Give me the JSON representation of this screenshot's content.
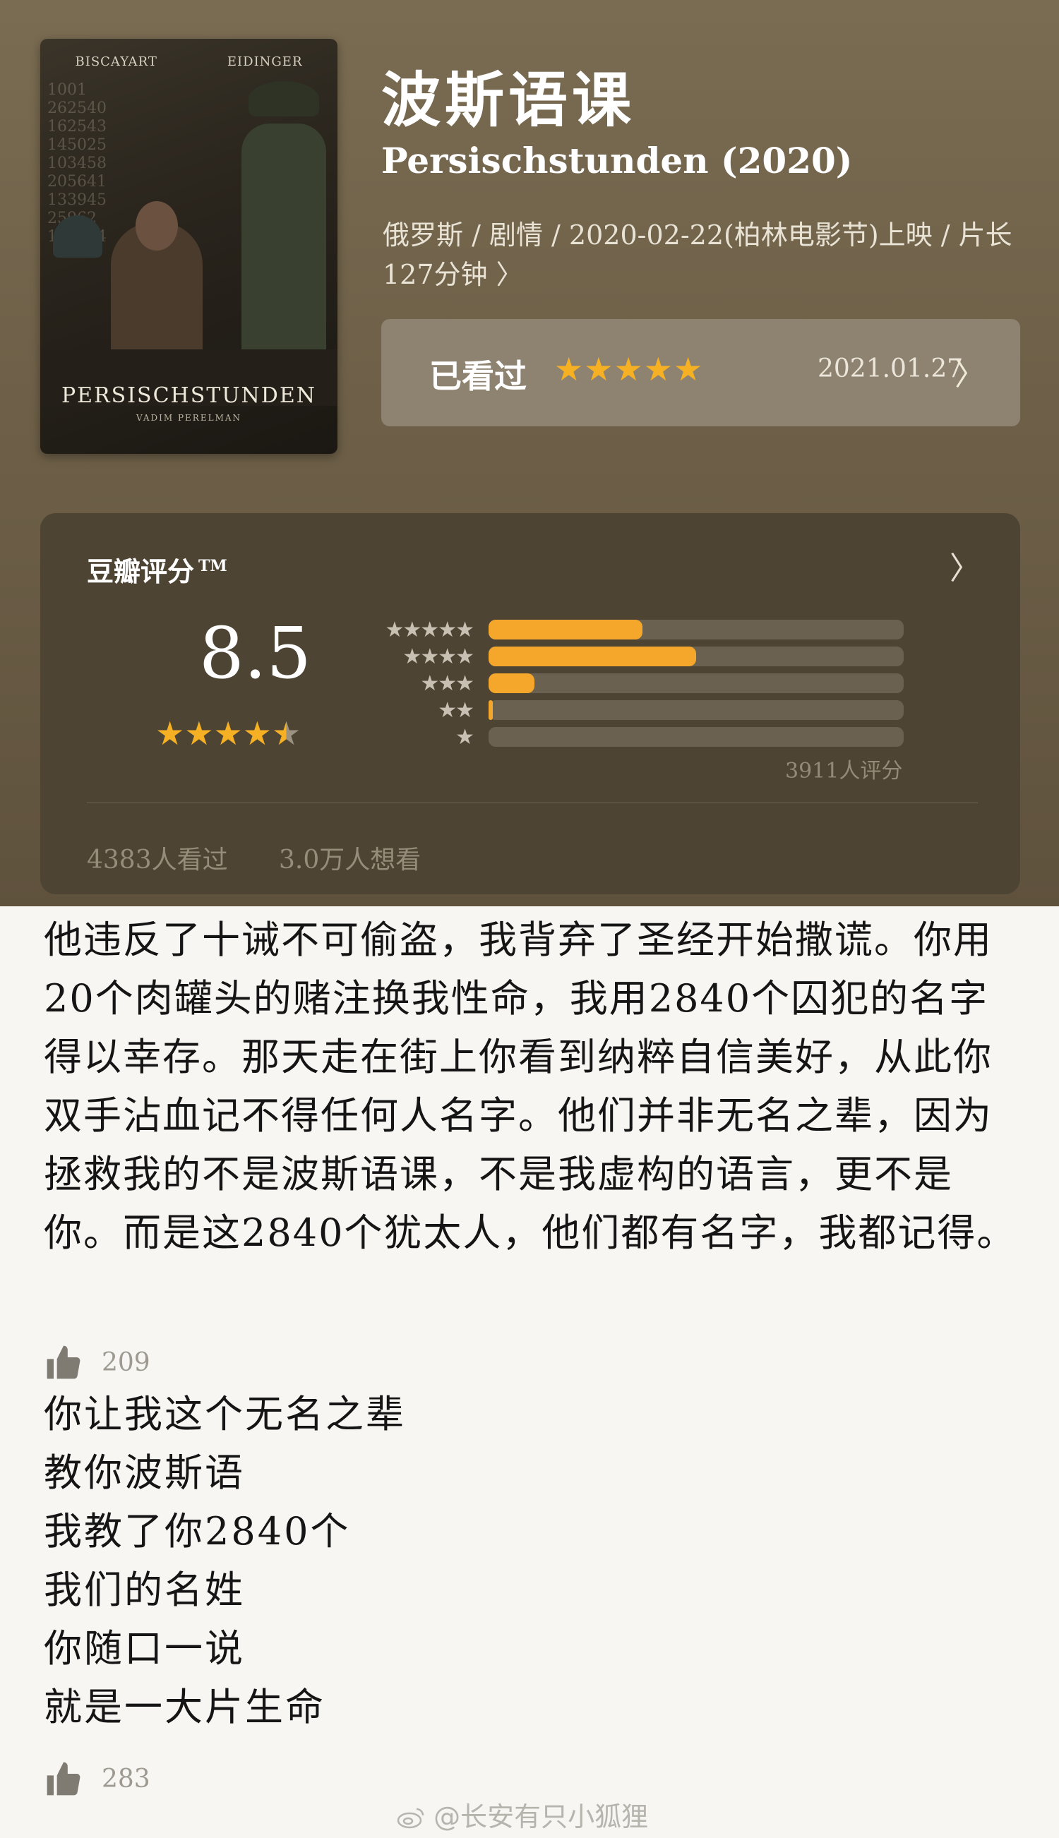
{
  "poster": {
    "credit_left": "BISCAYART",
    "credit_right": "EIDINGER",
    "title": "PERSISCHSTUNDEN",
    "director": "VADIM PERELMAN",
    "background_numbers": "1001\n262540\n162543\n145025\n103458\n205641\n133945\n25962\n130014"
  },
  "movie": {
    "title_cn": "波斯语课",
    "title_en": "Persischstunden (2020)",
    "meta": "俄罗斯 / 剧情 / 2020-02-22(柏林电影节)上映 / 片长127分钟 〉"
  },
  "watched": {
    "label": "已看过",
    "stars": "★★★★★",
    "date": "2021.01.27",
    "chevron": "〉"
  },
  "rating": {
    "header": "豆瓣评分",
    "tm": "TM",
    "score": "8.5",
    "stars_full": "★★★★",
    "star_half": "★",
    "chevron": "〉",
    "count": "3911人评分",
    "seen": "4383人看过",
    "want": "3.0万人想看",
    "accent": "#f4a72b"
  },
  "chart_data": {
    "type": "bar",
    "categories": [
      "★★★★★",
      "★★★★",
      "★★★",
      "★★",
      "★"
    ],
    "values": [
      0.37,
      0.5,
      0.11,
      0.01,
      0.0
    ]
  },
  "comment1": {
    "text": "他违反了十诫不可偷盗，我背弃了圣经开始撒谎。你用20个肉罐头的赌注换我性命，我用2840个囚犯的名字得以幸存。那天走在街上你看到纳粹自信美好，从此你双手沾血记不得任何人名字。他们并非无名之辈，因为拯救我的不是波斯语课，不是我虚构的语言，更不是你。而是这2840个犹太人，他们都有名字，我都记得。",
    "likes": "209"
  },
  "comment2": {
    "lines": [
      "你让我这个无名之辈",
      "教你波斯语",
      "我教了你2840个",
      "我们的名姓",
      "你随口一说",
      "就是一大片生命"
    ],
    "likes": "283"
  },
  "watermark": "@长安有只小狐狸"
}
